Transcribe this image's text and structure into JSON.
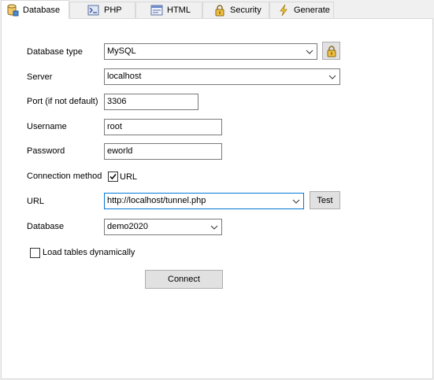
{
  "tabs": [
    {
      "label": "Database",
      "icon": "database-icon",
      "active": true
    },
    {
      "label": "PHP",
      "icon": "php-icon"
    },
    {
      "label": "HTML",
      "icon": "html-icon"
    },
    {
      "label": "Security",
      "icon": "lock-icon"
    },
    {
      "label": "Generate",
      "icon": "lightning-icon"
    }
  ],
  "form": {
    "database_type": {
      "label": "Database type",
      "value": "MySQL",
      "lock_icon": "lock-icon"
    },
    "server": {
      "label": "Server",
      "value": "localhost"
    },
    "port": {
      "label": "Port (if not default)",
      "value": "3306"
    },
    "username": {
      "label": "Username",
      "value": "root"
    },
    "password": {
      "label": "Password",
      "value": "eworld"
    },
    "connection_method": {
      "label": "Connection method",
      "option_label": "URL",
      "checked": true
    },
    "url": {
      "label": "URL",
      "value": "http://localhost/tunnel.php",
      "test_label": "Test"
    },
    "database": {
      "label": "Database",
      "value": "demo2020"
    },
    "load_tables": {
      "label": "Load tables dynamically",
      "checked": false
    },
    "connect_label": "Connect"
  },
  "colors": {
    "focus_border": "#0078d7",
    "panel_bg": "#ffffff",
    "window_bg": "#f0f0f0"
  }
}
